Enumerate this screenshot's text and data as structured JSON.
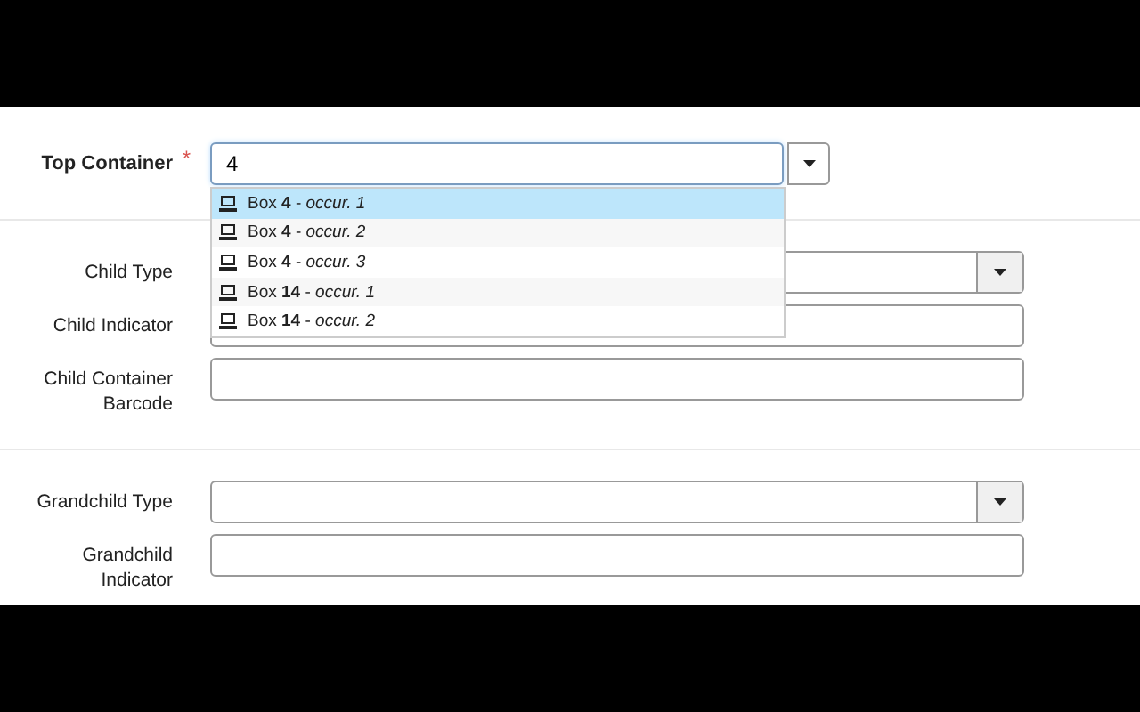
{
  "sections": [
    {
      "fields": [
        {
          "kind": "typeahead",
          "label": "Top Container",
          "required_mark": "*",
          "value": "4",
          "options": [
            {
              "label": "Box **4** - *occur. 1*",
              "selected": true
            },
            {
              "label": "Box **4** - *occur. 2*",
              "selected": false
            },
            {
              "label": "Box **4** - *occur. 3*",
              "selected": false
            },
            {
              "label": "Box **14** - *occur. 1*",
              "selected": false
            },
            {
              "label": "Box **14** - *occur. 2*",
              "selected": false
            }
          ]
        }
      ]
    },
    {
      "fields": [
        {
          "kind": "select",
          "label": "Child Type"
        },
        {
          "kind": "text",
          "label": "Child Indicator"
        },
        {
          "kind": "text",
          "label": "Child Container Barcode"
        }
      ]
    },
    {
      "fields": [
        {
          "kind": "select",
          "label": "Grandchild Type"
        },
        {
          "kind": "text",
          "label": "Grandchild Indicator"
        }
      ]
    }
  ]
}
